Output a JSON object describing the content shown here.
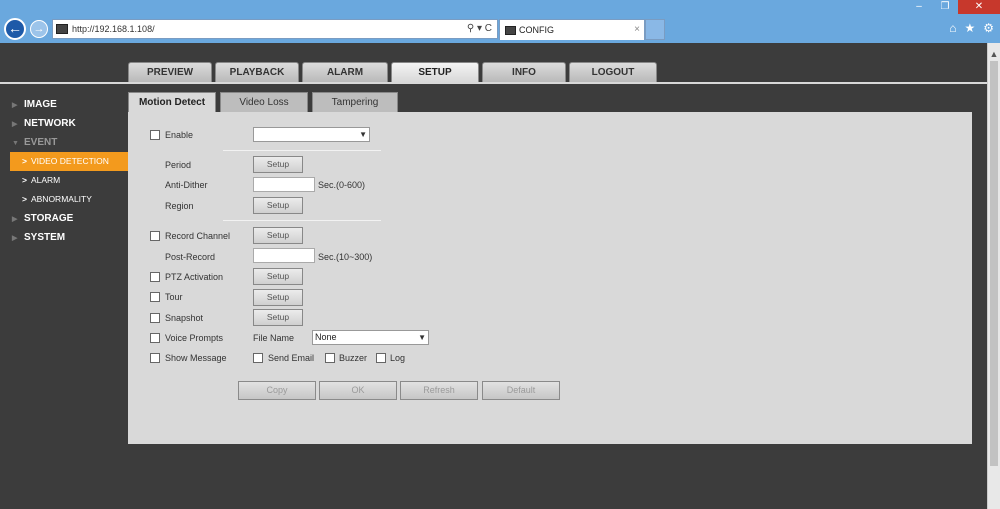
{
  "browser": {
    "url": "http://192.168.1.108/",
    "tab_title": "CONFIG",
    "tab_close": "×",
    "window_controls": [
      "–",
      "❐",
      "✕"
    ],
    "addr_icons": "⚲ ▾ C",
    "tool_icons": [
      "home-icon",
      "star-icon",
      "gear-icon"
    ]
  },
  "top_menu": [
    "PREVIEW",
    "PLAYBACK",
    "ALARM",
    "SETUP",
    "INFO",
    "LOGOUT"
  ],
  "top_menu_active": "SETUP",
  "sidebar": {
    "items": [
      {
        "label": "IMAGE"
      },
      {
        "label": "NETWORK"
      },
      {
        "label": "EVENT"
      },
      {
        "label": "VIDEO DETECTION"
      },
      {
        "label": "ALARM"
      },
      {
        "label": "ABNORMALITY"
      },
      {
        "label": "STORAGE"
      },
      {
        "label": "SYSTEM"
      }
    ]
  },
  "content_tabs": [
    "Motion Detect",
    "Video Loss",
    "Tampering"
  ],
  "form": {
    "enable": "Enable",
    "enable_select": "",
    "period": "Period",
    "anti_dither": "Anti-Dither",
    "anti_dither_unit": "Sec.(0-600)",
    "region": "Region",
    "record_channel": "Record Channel",
    "post_record": "Post-Record",
    "post_record_unit": "Sec.(10~300)",
    "ptz_activation": "PTZ Activation",
    "tour": "Tour",
    "snapshot": "Snapshot",
    "voice_prompts": "Voice Prompts",
    "file_name": "File Name",
    "file_name_value": "None",
    "show_message": "Show Message",
    "send_email": "Send Email",
    "buzzer": "Buzzer",
    "log": "Log",
    "setup_label": "Setup"
  },
  "buttons": [
    "Copy",
    "OK",
    "Refresh",
    "Default"
  ]
}
